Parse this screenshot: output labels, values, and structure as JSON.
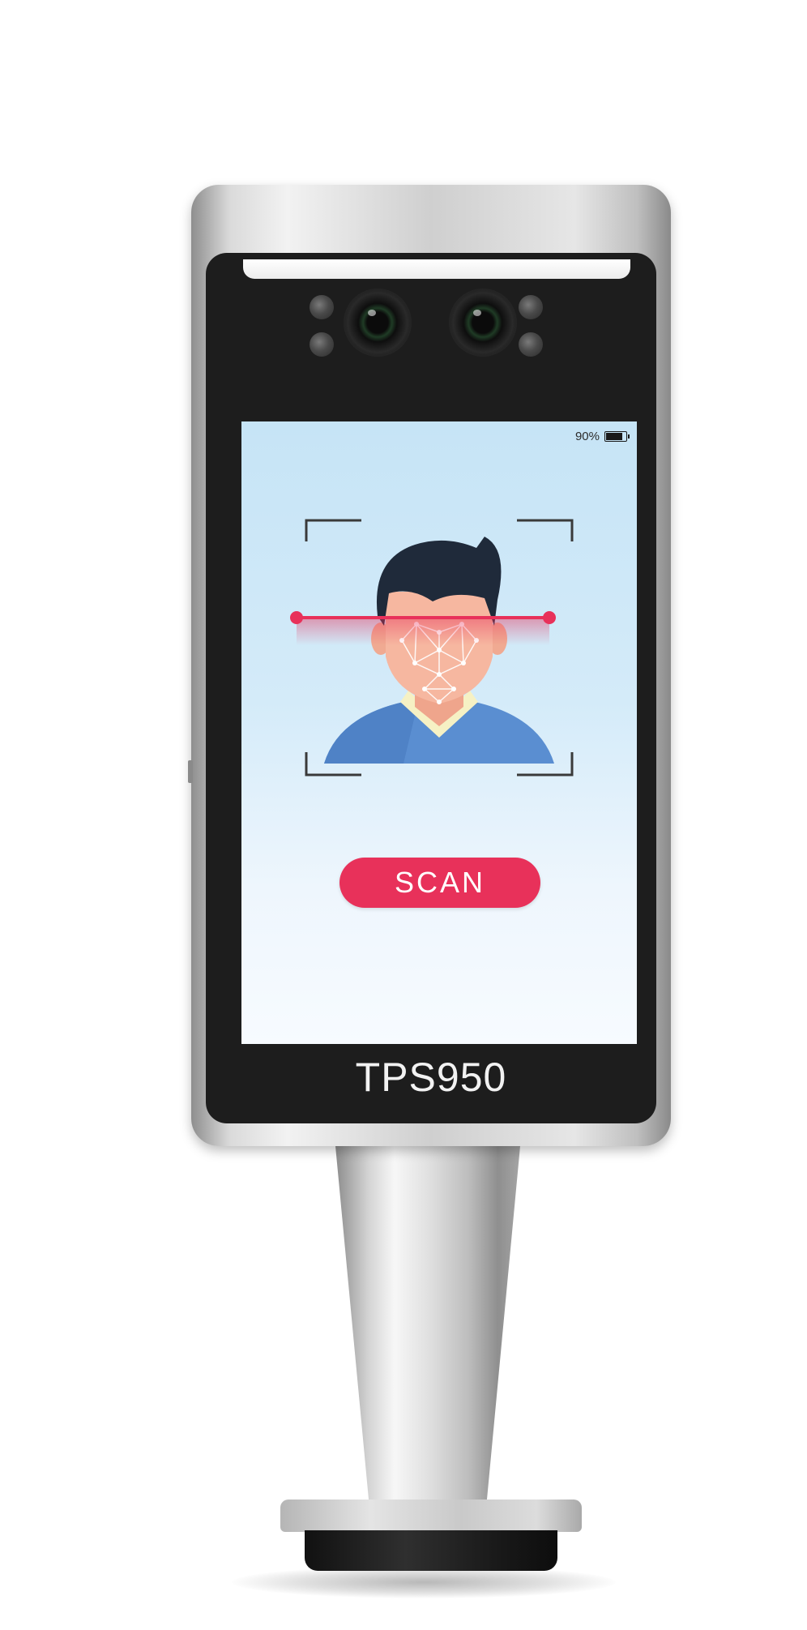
{
  "device": {
    "model": "TPS950"
  },
  "screen": {
    "status": {
      "battery_percent_label": "90%",
      "battery_level": 0.9
    },
    "scan_button_label": "SCAN"
  },
  "colors": {
    "accent": "#e8315a",
    "screen_top": "#c6e4f6",
    "screen_bottom": "#f7fbff",
    "bezel": "#1d1d1d",
    "hair": "#1f2a3a",
    "skin": "#f6b7a0",
    "shirt": "#5a8ed1",
    "collar": "#f6f1c4"
  },
  "icons": {
    "battery": "battery-icon",
    "camera": "camera-icon",
    "scan_target": "face-scan-icon"
  }
}
